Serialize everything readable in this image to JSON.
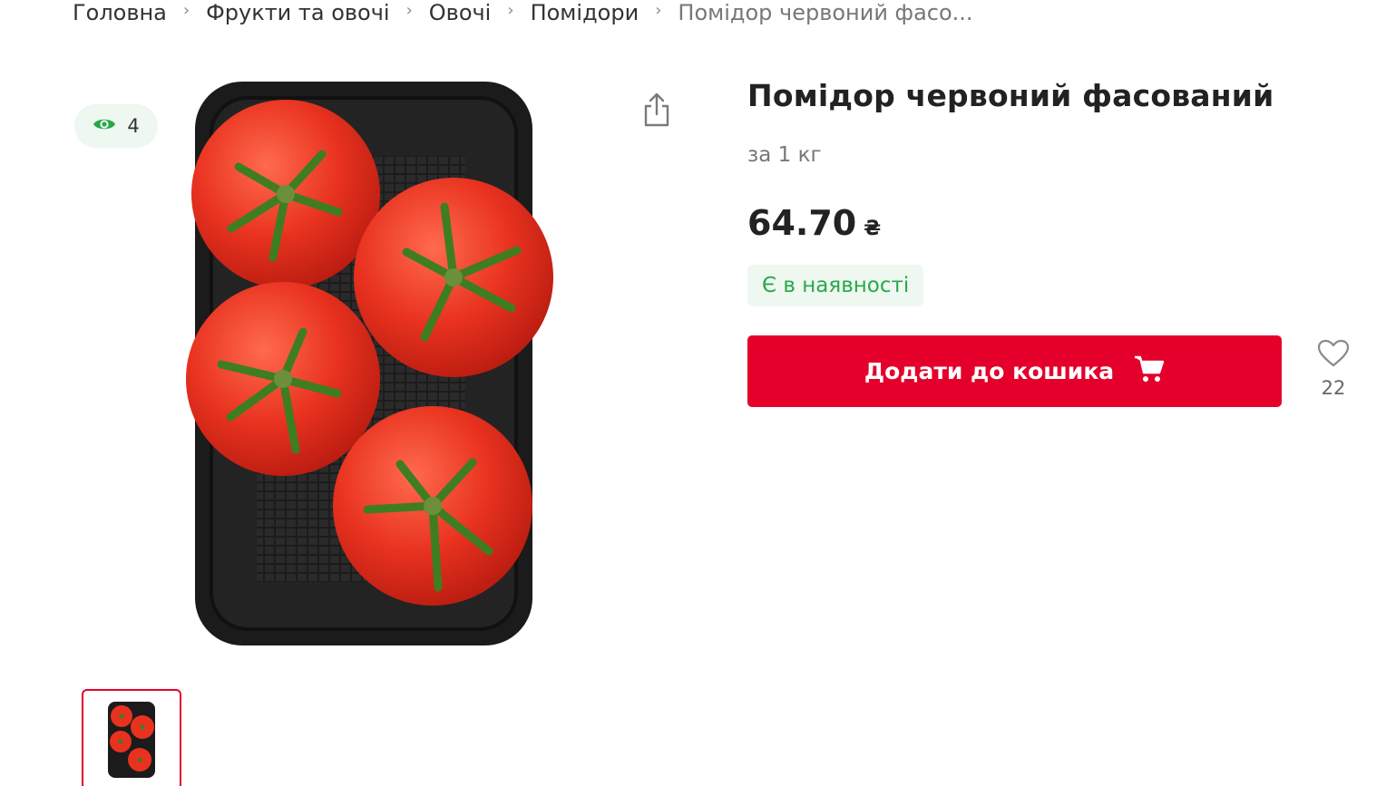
{
  "breadcrumb": {
    "items": [
      "Головна",
      "Фрукти та овочі",
      "Овочі",
      "Помідори",
      "Помідор червоний фасо..."
    ]
  },
  "gallery": {
    "views_count": "4",
    "icons": {
      "views": "eye-icon",
      "share": "share-icon"
    }
  },
  "product": {
    "title": "Помідор червоний фасований",
    "unit": "за 1 кг",
    "price": "64.70",
    "currency": "₴",
    "stock_status": "Є в наявності",
    "add_to_cart_label": "Додати до кошика",
    "favorites_count": "22"
  },
  "colors": {
    "accent_red": "#e4002b",
    "stock_green": "#2aa74a",
    "stock_bg": "#eef8f1",
    "views_green": "#27a84a"
  }
}
